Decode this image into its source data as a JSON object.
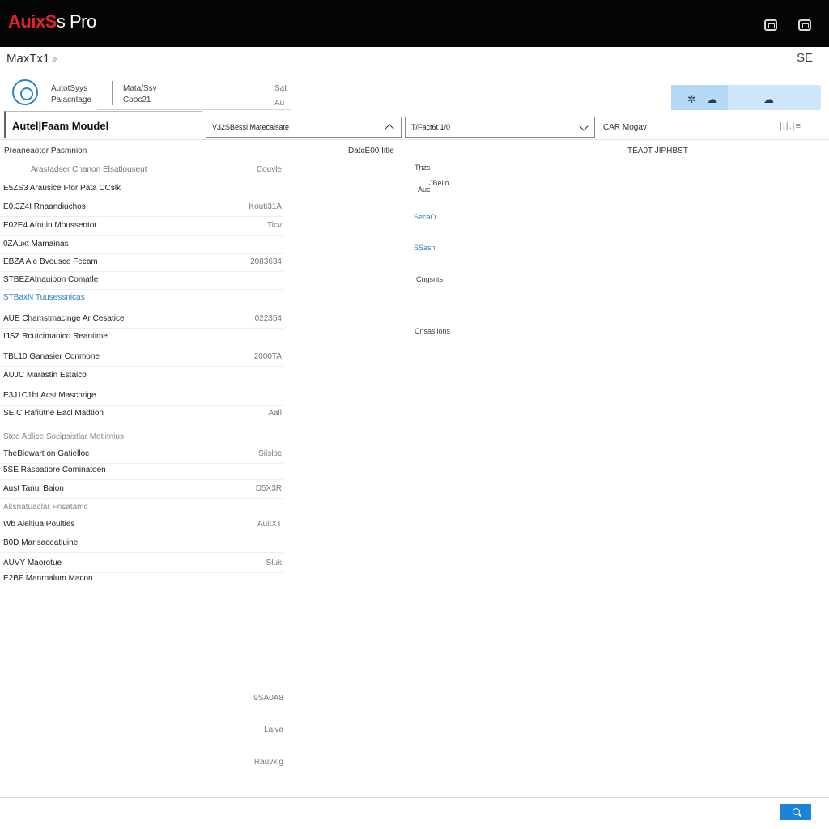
{
  "app": {
    "brand_part1": "AuixS",
    "brand_part2": "s Pro"
  },
  "window": {
    "title": "MaxTx1",
    "title_suffix": "⁄⁄⁄",
    "close_label": "SE"
  },
  "info": {
    "col1_line1": "AutotSyys",
    "col1_line2": "Palacntage",
    "col2_line1": "Mata/Ssv",
    "col2_line2": "Cooc21",
    "col3_line1": "Sat",
    "col3_line2": "Au"
  },
  "filters": {
    "model_label": "Autel|Faam Moudel",
    "select1_value": "V32SBessl Matecalsate",
    "select2_value": "T/Fact6t 1/0",
    "right_label": "CAR Mogav",
    "filter_icon": "|||.|≡"
  },
  "columns": {
    "col1": "Preaneaotor Pasmnion",
    "col2": "DatcE00 Iitle",
    "col3": "TEA0T JIPHBST"
  },
  "items": [
    {
      "name": "Arastadser Chanon Elsatlouseut",
      "value": "Couvle",
      "style": "sub"
    },
    {
      "name": "E5ZS3 Arausice Ftor Pata CCslk",
      "value": "",
      "style": ""
    },
    {
      "name": "E0.3Z4I Rnaandiuchos",
      "value": "Kouti31A",
      "style": ""
    },
    {
      "name": "E02E4 Afnuin Moussentor",
      "value": "Ticv",
      "style": ""
    },
    {
      "name": "0ZAuxt Mamainas",
      "value": "",
      "style": ""
    },
    {
      "name": "EBZA Ale Bvousce Fecam",
      "value": "2083634",
      "style": ""
    },
    {
      "name": "STBEZAtnauioon Comatle",
      "value": "",
      "style": ""
    },
    {
      "name": "STBaxN Tuusessnicas",
      "value": "",
      "style": "link"
    },
    {
      "name": "AUE Chamstmacinge Ar Cesatice",
      "value": "022354",
      "style": ""
    },
    {
      "name": "IJSZ Rcutcimanico Reantime",
      "value": "",
      "style": ""
    },
    {
      "name": "TBL10 Ganasier Conmone",
      "value": "2000TA",
      "style": ""
    },
    {
      "name": "AUJC Marastin Estaico",
      "value": "",
      "style": ""
    },
    {
      "name": "E3J1C1bt Acst Maschrige",
      "value": "",
      "style": ""
    },
    {
      "name": "SE C Rafiutne Eacl Madtion",
      "value": "Aall",
      "style": ""
    },
    {
      "name": "Steo Adlice Socipsistlar Motiitnius",
      "value": "",
      "style": "faded"
    },
    {
      "name": "TheBlowart on Gatielloc",
      "value": "Silsloc",
      "style": ""
    },
    {
      "name": "5SE Rasbatiore Cominatoen",
      "value": "",
      "style": ""
    },
    {
      "name": "Aust Tanul Baion",
      "value": "D5X3R",
      "style": ""
    },
    {
      "name": "Aksnatuaclar Fnsatamc",
      "value": "",
      "style": "faded"
    },
    {
      "name": "Wb Aleltiua Poulties",
      "value": "AuitXT",
      "style": ""
    },
    {
      "name": "B0D Marlsaceatluine",
      "value": "",
      "style": ""
    },
    {
      "name": "AUVY Maorotue",
      "value": "Sluk",
      "style": ""
    },
    {
      "name": "E2BF Manrnalum Macon",
      "value": "",
      "style": ""
    }
  ],
  "middle": {
    "a": "Thzs",
    "b": "JBelio",
    "c": "Auc",
    "d": "SecaO",
    "e": "SSasn",
    "f": "Cngsnts",
    "g": "Cnsasiions"
  },
  "lower": {
    "a": "9SA0A8",
    "b": "Laiva",
    "c": "Rauvxlg"
  },
  "colors": {
    "accent": "#1a84d8",
    "brand_red": "#e0232b",
    "titlebar": "#050505",
    "link": "#2d7cc7"
  },
  "icons": [
    "monitor-icon",
    "settings-icon",
    "cloud-icon",
    "chevron-down-icon",
    "search-icon",
    "filter-icon",
    "logo-icon"
  ]
}
